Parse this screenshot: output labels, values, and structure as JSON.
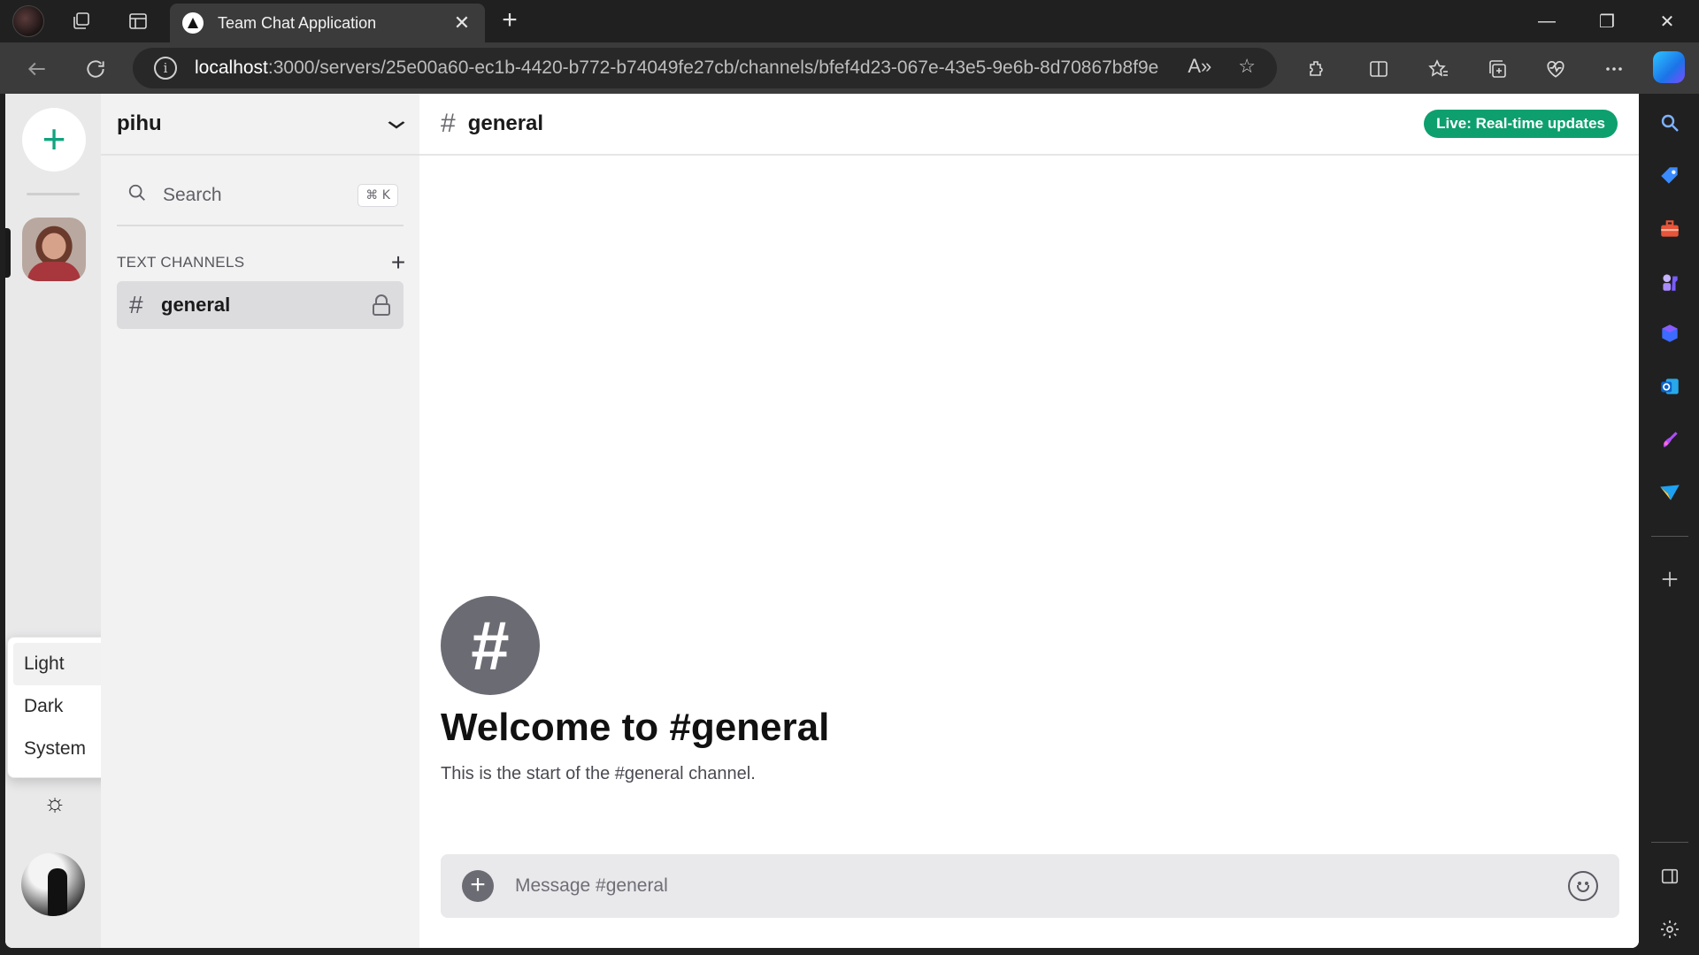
{
  "browser": {
    "tab_title": "Team Chat Application",
    "tab_close": "✕",
    "new_tab": "+",
    "url_host": "localhost",
    "url_path": ":3000/servers/25e00a60-ec1b-4420-b772-b74049fe27cb/channels/bfef4d23-067e-43e5-9e6b-8d70867b8f9e",
    "window_controls": {
      "minimize": "—",
      "restore": "❐",
      "close": "✕"
    },
    "read_aloud": "A»",
    "star": "☆"
  },
  "rail": {
    "add_server": "+",
    "theme_menu": {
      "items": [
        {
          "label": "Light",
          "active": true
        },
        {
          "label": "Dark",
          "active": false
        },
        {
          "label": "System",
          "active": false
        }
      ]
    },
    "theme_toggle_icon": "☼"
  },
  "channels_panel": {
    "server_name": "pihu",
    "search_label": "Search",
    "search_shortcut": "⌘ K",
    "section_label": "TEXT CHANNELS",
    "section_add": "+",
    "channels": [
      {
        "hash": "#",
        "name": "general",
        "locked": true,
        "active": true
      }
    ]
  },
  "chat": {
    "header_hash": "#",
    "header_name": "general",
    "live_badge": "Live: Real-time updates",
    "welcome_icon": "#",
    "welcome_title": "Welcome to #general",
    "welcome_subtitle": "This is the start of the #general channel.",
    "composer_placeholder": "Message #general",
    "composer_add": "+"
  },
  "colors": {
    "accent": "#10a37f",
    "live_badge": "#0e9f6e"
  }
}
